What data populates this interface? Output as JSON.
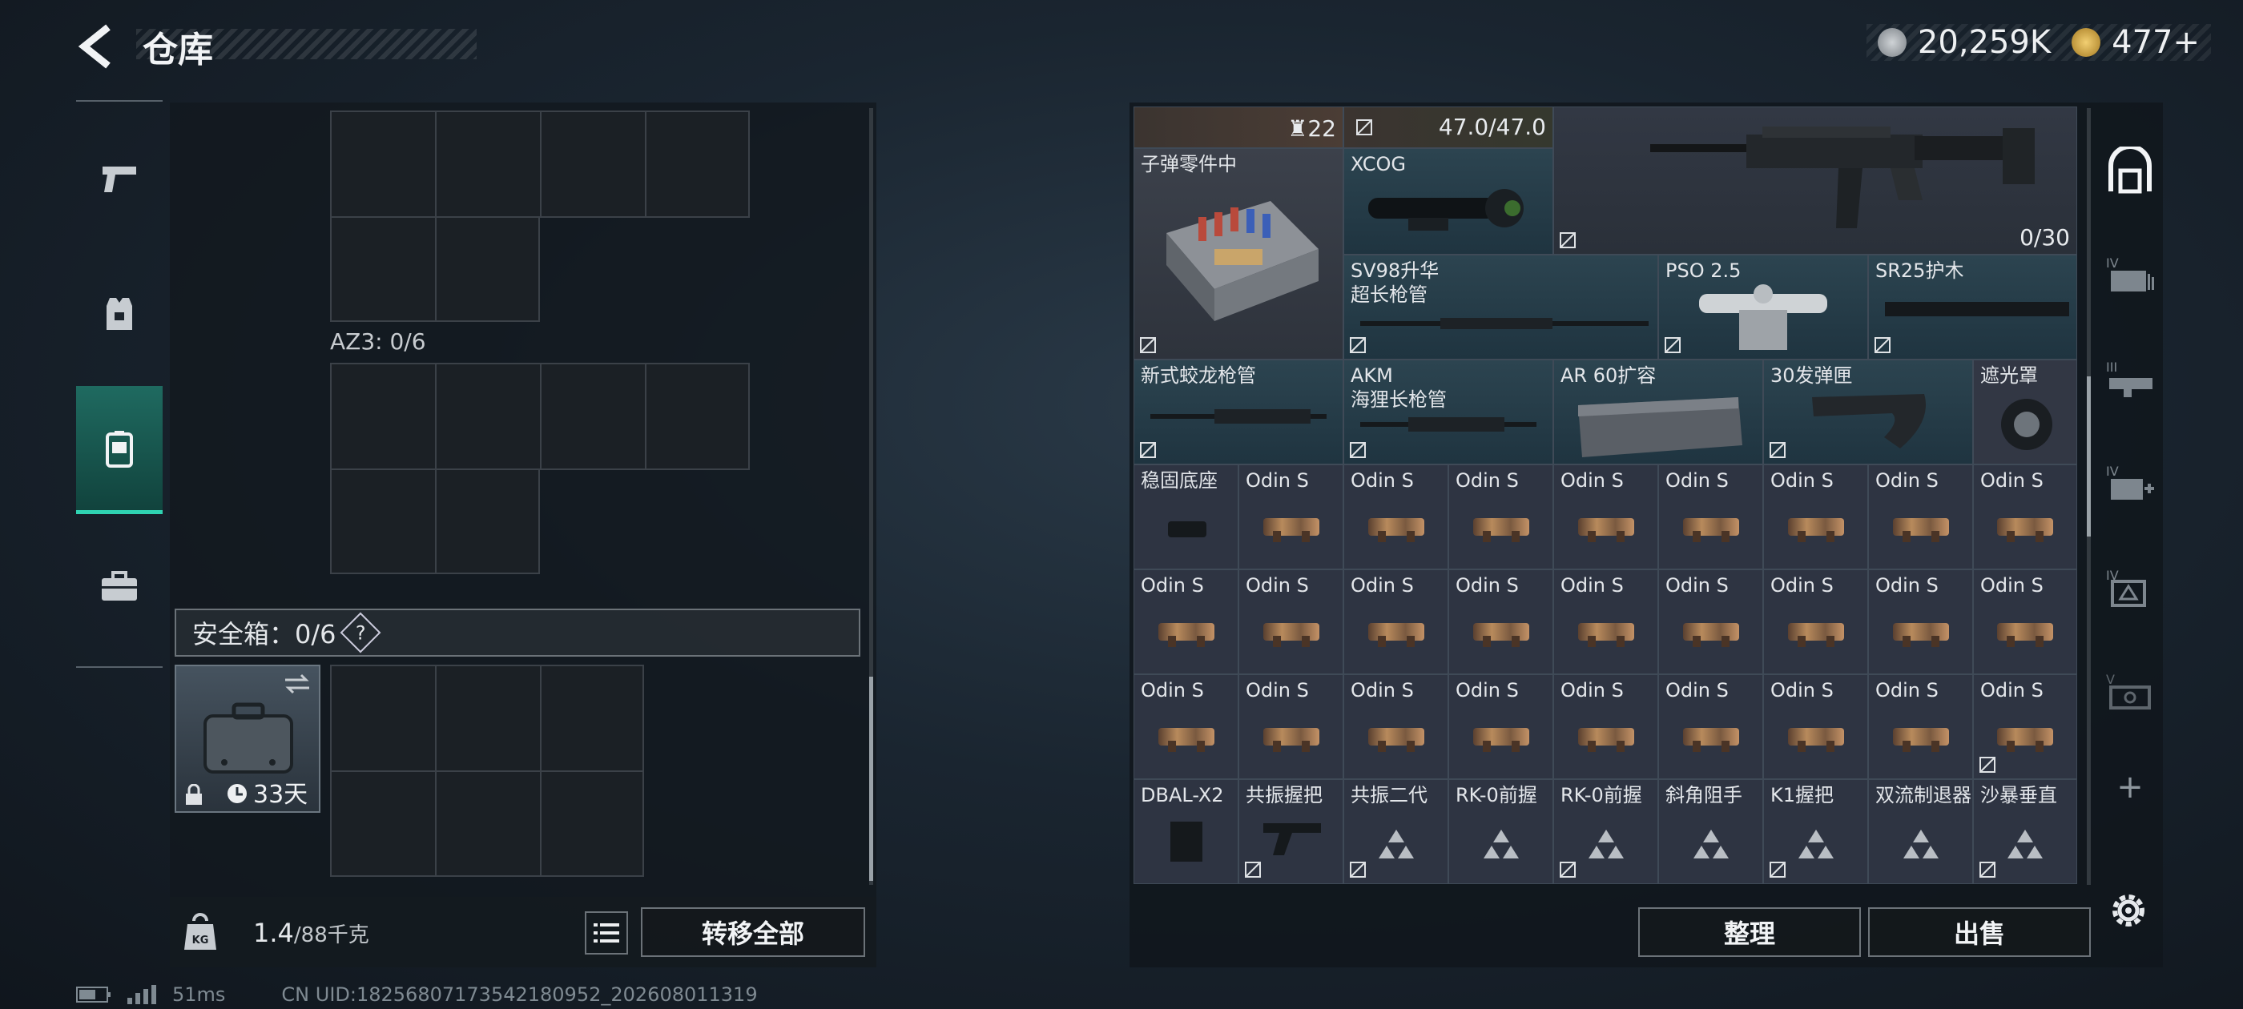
{
  "header": {
    "title": "仓库",
    "silver": "20,259K",
    "gold": "477",
    "gold_plus": "+"
  },
  "left_nav": {
    "items": [
      "weapons-tab",
      "gear-tab",
      "backpack-tab",
      "toolbox-tab"
    ],
    "active": 2
  },
  "storage": {
    "az3_label": "AZ3: 0/6",
    "safe_box_label": "安全箱：0/6",
    "safe_box_help": "?",
    "safe_box_days": "33天",
    "weight_current": "1.4",
    "weight_max": "/88千克",
    "transfer_all": "转移全部"
  },
  "warehouse": {
    "row0": {
      "count": "22",
      "durability": "47.0/47.0",
      "ammo": "0/30"
    },
    "cells": [
      {
        "label": "子弹零件中"
      },
      {
        "label": "XCOG"
      },
      {
        "label": "SV98升华\n超长枪管"
      },
      {
        "label": "PSO 2.5"
      },
      {
        "label": "SR25护木"
      },
      {
        "label": "新式蛟龙枪管"
      },
      {
        "label": "AKM\n海狸长枪管"
      },
      {
        "label": "AR 60扩容"
      },
      {
        "label": "30发弹匣"
      },
      {
        "label": "遮光罩"
      },
      {
        "label": "稳固底座"
      },
      {
        "label": "Odin S"
      },
      {
        "label": "DBAL-X2"
      },
      {
        "label": "共振握把"
      },
      {
        "label": "共振二代"
      },
      {
        "label": "RK-0前握"
      },
      {
        "label": "RK-0前握"
      },
      {
        "label": "斜角阻手"
      },
      {
        "label": "K1握把"
      },
      {
        "label": "双流制退器"
      },
      {
        "label": "沙暴垂直"
      }
    ],
    "sort_label": "整理",
    "sell_label": "出售"
  },
  "right_nav": {
    "tabs": [
      "IV",
      "III",
      "IV",
      "IV",
      "V"
    ],
    "add": "+"
  },
  "status_bar": {
    "ping": "51ms",
    "uid": "CN UID:18256807173542180952_202608011319"
  },
  "colors": {
    "accent": "#2fd3b2",
    "cell_bg": "#2e3442",
    "cell_teal": "#2c4450"
  }
}
